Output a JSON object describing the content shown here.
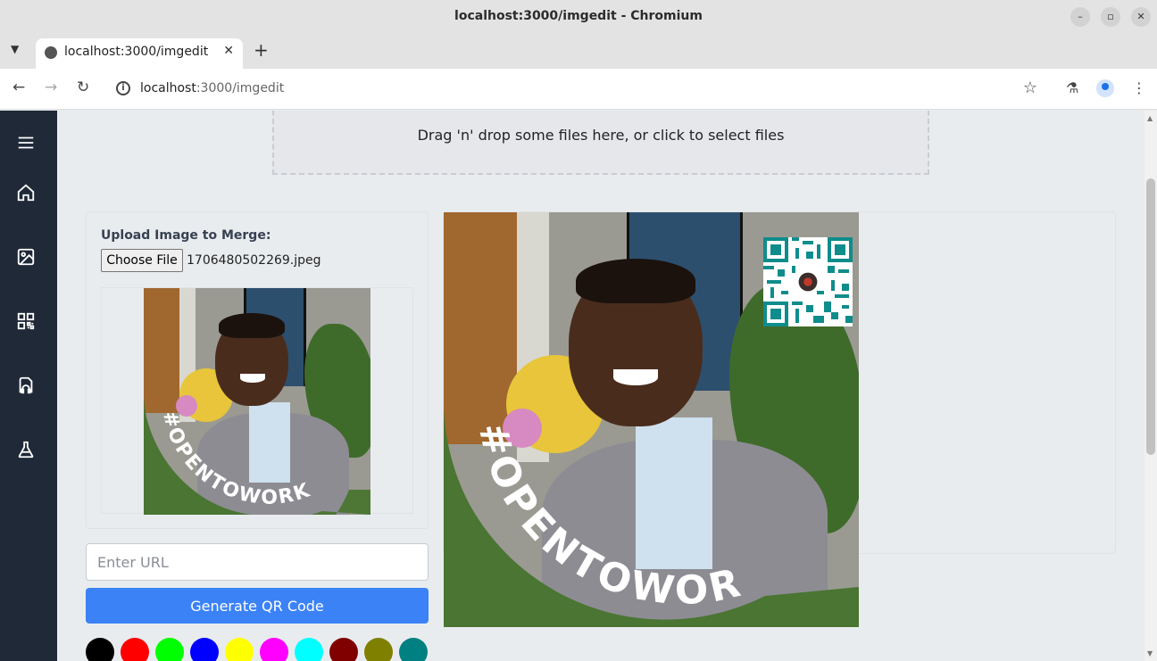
{
  "browser": {
    "window_title": "localhost:3000/imgedit - Chromium",
    "tab_label": "localhost:3000/imgedit",
    "url_host": "localhost",
    "url_path": ":3000/imgedit"
  },
  "sidebar": {
    "items": [
      {
        "icon": "menu-icon"
      },
      {
        "icon": "home-icon"
      },
      {
        "icon": "image-icon"
      },
      {
        "icon": "qr-code-icon"
      },
      {
        "icon": "audio-file-icon"
      },
      {
        "icon": "flask-icon"
      }
    ]
  },
  "dropzone": {
    "text": "Drag 'n' drop some files here, or click to select files"
  },
  "merge": {
    "label": "Upload Image to Merge:",
    "choose_file": "Choose File",
    "file_name": "1706480502269.jpeg"
  },
  "photo": {
    "banner_text": "#OPENTOWORK"
  },
  "qr": {
    "url_placeholder": "Enter URL",
    "generate_label": "Generate QR Code",
    "colors": [
      "#000000",
      "#ff0000",
      "#00ff00",
      "#0000ff",
      "#ffff00",
      "#ff00ff",
      "#00ffff",
      "#800000",
      "#808000",
      "#008080"
    ]
  }
}
